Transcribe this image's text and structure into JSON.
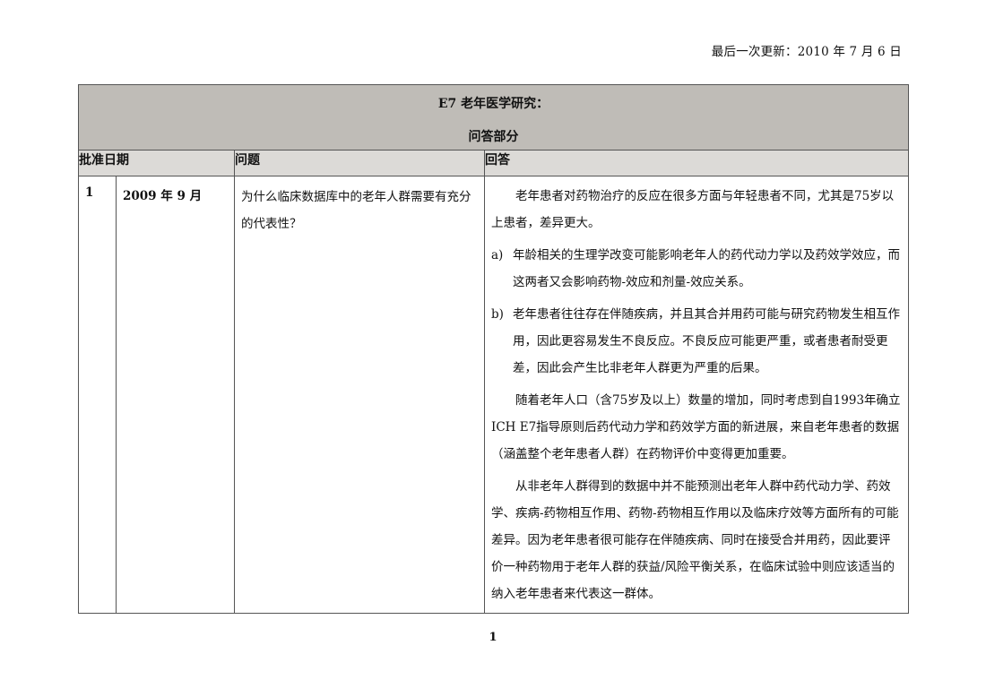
{
  "header": {
    "last_updated": "最后一次更新：2010 年 7 月 6 日"
  },
  "table": {
    "title_line1": "E7 老年医学研究：",
    "title_line2": "问答部分",
    "columns": {
      "date": "批准日期",
      "question": "问题",
      "answer": "回答"
    },
    "rows": [
      {
        "number": "1",
        "date": "2009 年 9 月",
        "question": "为什么临床数据库中的老年人群需要有充分的代表性？",
        "answer": {
          "intro": "老年患者对药物治疗的反应在很多方面与年轻患者不同，尤其是75岁以上患者，差异更大。",
          "items": [
            {
              "marker": "a)",
              "text": "年龄相关的生理学改变可能影响老年人的药代动力学以及药效学效应，而这两者又会影响药物-效应和剂量-效应关系。"
            },
            {
              "marker": "b)",
              "text": "老年患者往往存在伴随疾病，并且其合并用药可能与研究药物发生相互作用，因此更容易发生不良反应。不良反应可能更严重，或者患者耐受更差，因此会产生比非老年人群更为严重的后果。"
            }
          ],
          "para2": "随着老年人口（含75岁及以上）数量的增加，同时考虑到自1993年确立ICH E7指导原则后药代动力学和药效学方面的新进展，来自老年患者的数据（涵盖整个老年患者人群）在药物评价中变得更加重要。",
          "para3": "从非老年人群得到的数据中并不能预测出老年人群中药代动力学、药效学、疾病-药物相互作用、药物-药物相互作用以及临床疗效等方面所有的可能差异。因为老年患者很可能存在伴随疾病、同时在接受合并用药，因此要评价一种药物用于老年人群的获益/风险平衡关系，在临床试验中则应该适当的纳入老年患者来代表这一群体。"
        }
      }
    ]
  },
  "footer": {
    "page_number": "1"
  }
}
